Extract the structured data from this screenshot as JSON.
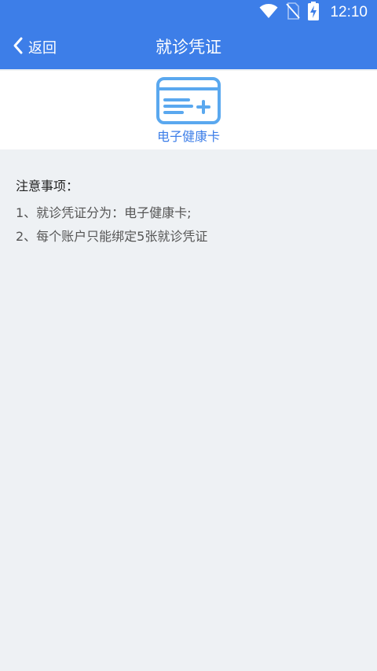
{
  "status_bar": {
    "time": "12:10",
    "icons": [
      "wifi-icon",
      "no-sim-icon",
      "battery-charging-icon"
    ]
  },
  "nav": {
    "back_label": "返回",
    "title": "就诊凭证"
  },
  "card_option": {
    "label": "电子健康卡",
    "icon": "health-card-icon"
  },
  "notes": {
    "title": "注意事项：",
    "items": [
      "1、就诊凭证分为：电子健康卡;",
      "2、每个账户只能绑定5张就诊凭证"
    ]
  },
  "colors": {
    "primary": "#3d7ee8",
    "icon_blue": "#5aa8ef",
    "background": "#eef1f4"
  }
}
